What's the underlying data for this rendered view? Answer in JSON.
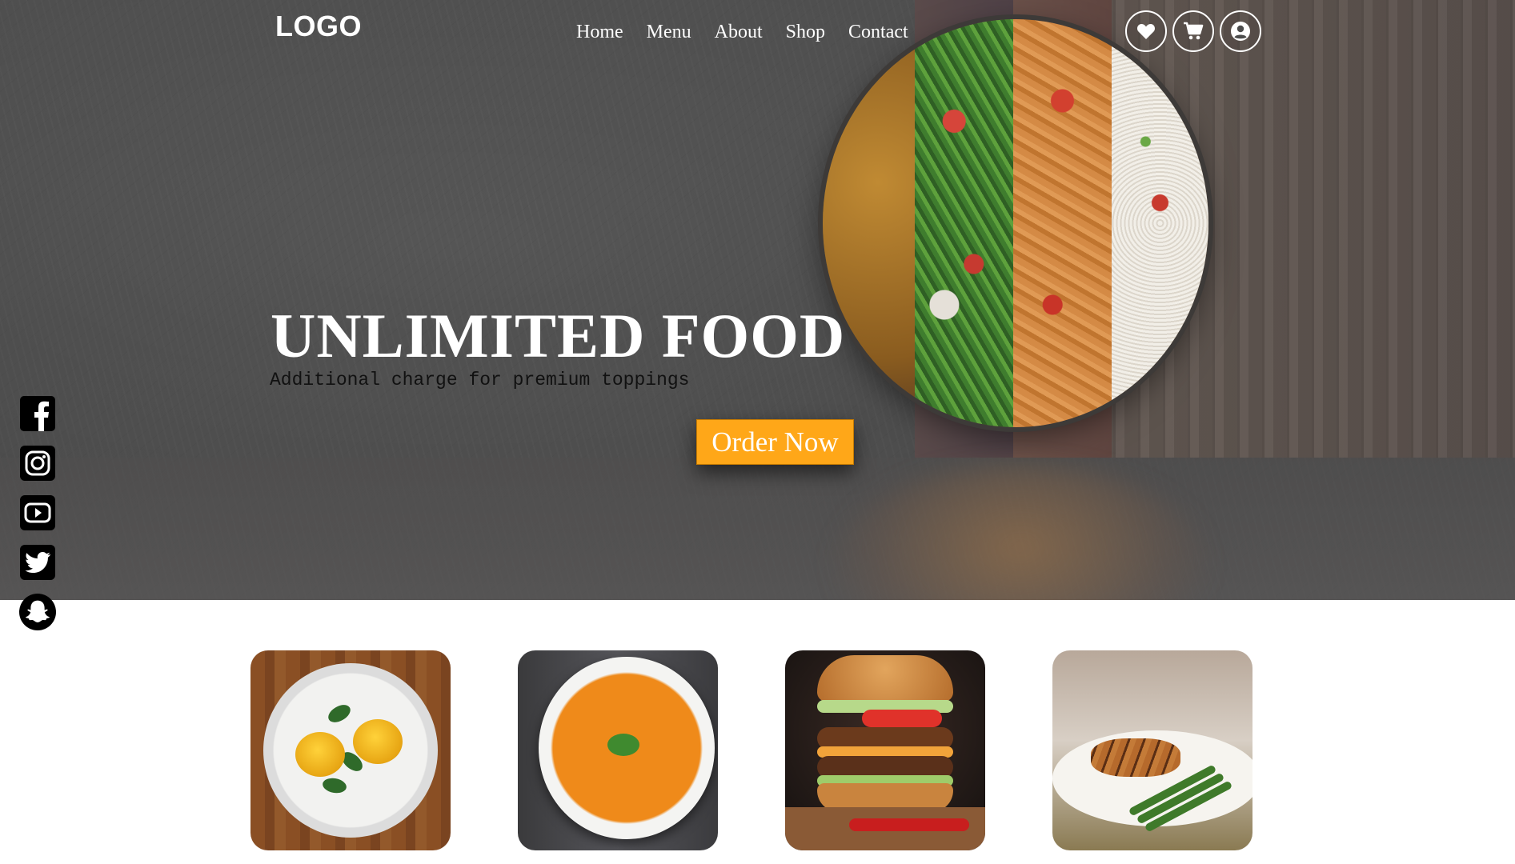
{
  "header": {
    "logo": "LOGO",
    "nav": [
      {
        "label": "Home"
      },
      {
        "label": "Menu"
      },
      {
        "label": "About"
      },
      {
        "label": "Shop"
      },
      {
        "label": "Contact"
      }
    ],
    "icons": [
      "heart-icon",
      "cart-icon",
      "user-icon"
    ]
  },
  "hero": {
    "title": "UNLIMITED FOOD",
    "subtitle": "Additional charge for premium toppings",
    "cta_label": "Order Now",
    "cta_color": "#ffa718"
  },
  "social": [
    "facebook-icon",
    "instagram-icon",
    "youtube-icon",
    "twitter-icon",
    "snapchat-icon"
  ],
  "cards": [
    {
      "image": "eggs-benedict-image"
    },
    {
      "image": "pumpkin-soup-image"
    },
    {
      "image": "burger-image"
    },
    {
      "image": "grilled-chicken-image"
    }
  ]
}
